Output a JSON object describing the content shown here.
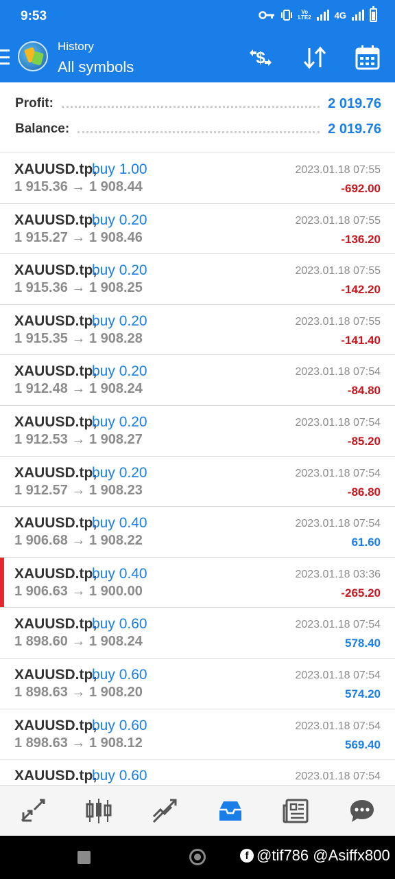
{
  "status_bar": {
    "time": "9:53",
    "network": "4G"
  },
  "header": {
    "title": "History",
    "subtitle": "All symbols",
    "icons": [
      "menu-icon",
      "app-logo",
      "currency-exchange-icon",
      "sort-icon",
      "calendar-icon"
    ]
  },
  "summary": {
    "profit_label": "Profit:",
    "profit_value": "2 019.76",
    "balance_label": "Balance:",
    "balance_value": "2 019.76"
  },
  "deals": [
    {
      "symbol": "XAUUSD.tp,",
      "type": "buy 1.00",
      "prices": "1 915.36 → 1 908.44",
      "time": "2023.01.18 07:55",
      "profit": "-692.00",
      "sign": "neg",
      "marked": false
    },
    {
      "symbol": "XAUUSD.tp,",
      "type": "buy 0.20",
      "prices": "1 915.27 → 1 908.46",
      "time": "2023.01.18 07:55",
      "profit": "-136.20",
      "sign": "neg",
      "marked": false
    },
    {
      "symbol": "XAUUSD.tp,",
      "type": "buy 0.20",
      "prices": "1 915.36 → 1 908.25",
      "time": "2023.01.18 07:55",
      "profit": "-142.20",
      "sign": "neg",
      "marked": false
    },
    {
      "symbol": "XAUUSD.tp,",
      "type": "buy 0.20",
      "prices": "1 915.35 → 1 908.28",
      "time": "2023.01.18 07:55",
      "profit": "-141.40",
      "sign": "neg",
      "marked": false
    },
    {
      "symbol": "XAUUSD.tp,",
      "type": "buy 0.20",
      "prices": "1 912.48 → 1 908.24",
      "time": "2023.01.18 07:54",
      "profit": "-84.80",
      "sign": "neg",
      "marked": false
    },
    {
      "symbol": "XAUUSD.tp,",
      "type": "buy 0.20",
      "prices": "1 912.53 → 1 908.27",
      "time": "2023.01.18 07:54",
      "profit": "-85.20",
      "sign": "neg",
      "marked": false
    },
    {
      "symbol": "XAUUSD.tp,",
      "type": "buy 0.20",
      "prices": "1 912.57 → 1 908.23",
      "time": "2023.01.18 07:54",
      "profit": "-86.80",
      "sign": "neg",
      "marked": false
    },
    {
      "symbol": "XAUUSD.tp,",
      "type": "buy 0.40",
      "prices": "1 906.68 → 1 908.22",
      "time": "2023.01.18 07:54",
      "profit": "61.60",
      "sign": "pos",
      "marked": false
    },
    {
      "symbol": "XAUUSD.tp,",
      "type": "buy 0.40",
      "prices": "1 906.63 → 1 900.00",
      "time": "2023.01.18 03:36",
      "profit": "-265.20",
      "sign": "neg",
      "marked": true
    },
    {
      "symbol": "XAUUSD.tp,",
      "type": "buy 0.60",
      "prices": "1 898.60 → 1 908.24",
      "time": "2023.01.18 07:54",
      "profit": "578.40",
      "sign": "pos",
      "marked": false
    },
    {
      "symbol": "XAUUSD.tp,",
      "type": "buy 0.60",
      "prices": "1 898.63 → 1 908.20",
      "time": "2023.01.18 07:54",
      "profit": "574.20",
      "sign": "pos",
      "marked": false
    },
    {
      "symbol": "XAUUSD.tp,",
      "type": "buy 0.60",
      "prices": "1 898.63 → 1 908.12",
      "time": "2023.01.18 07:54",
      "profit": "569.40",
      "sign": "pos",
      "marked": false
    },
    {
      "symbol": "XAUUSD.tp,",
      "type": "buy 0.60",
      "prices": "",
      "time": "2023.01.18 07:54",
      "profit": "",
      "sign": "pos",
      "marked": false
    }
  ],
  "bottom_nav": {
    "items": [
      "quotes-icon",
      "chart-icon",
      "trade-icon",
      "history-icon",
      "news-icon",
      "chat-icon"
    ],
    "active": "history-icon"
  },
  "watermark": "@tif786 @Asiffx800",
  "colors": {
    "accent": "#1a7ee8",
    "negative": "#c8161d",
    "marker": "#e0282e"
  }
}
